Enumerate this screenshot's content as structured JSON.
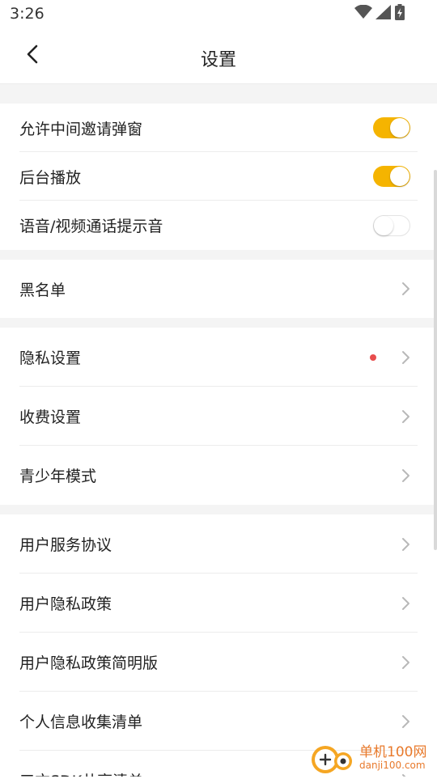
{
  "status_bar": {
    "time": "3:26",
    "icons": [
      "wifi-icon",
      "signal-icon",
      "battery-charging-icon"
    ]
  },
  "nav": {
    "title": "设置",
    "back_icon": "chevron-left-icon"
  },
  "toggles": [
    {
      "label": "允许中间邀请弹窗",
      "on": true
    },
    {
      "label": "后台播放",
      "on": true
    },
    {
      "label": "语音/视频通话提示音",
      "on": false
    }
  ],
  "blacklist": {
    "label": "黑名单"
  },
  "settings_group": [
    {
      "label": "隐私设置",
      "dot": true
    },
    {
      "label": "收费设置"
    },
    {
      "label": "青少年模式"
    }
  ],
  "policy_group": [
    {
      "label": "用户服务协议"
    },
    {
      "label": "用户隐私政策"
    },
    {
      "label": "用户隐私政策简明版"
    },
    {
      "label": "个人信息收集清单"
    },
    {
      "label": "三方SDK共享清单"
    }
  ],
  "watermark": {
    "title": "单机100网",
    "url": "danji100.com"
  },
  "colors": {
    "accent": "#f5b400",
    "dot": "#e84d4d",
    "chevron": "#b8b8b8",
    "background": "#f4f4f4",
    "watermark": "#e8792b"
  }
}
